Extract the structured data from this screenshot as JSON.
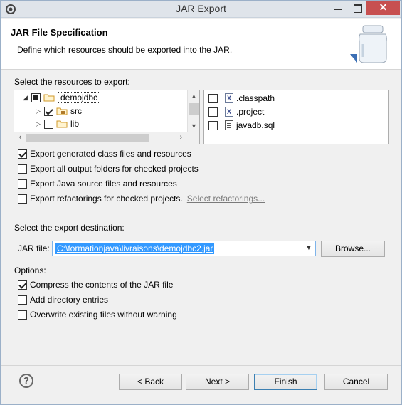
{
  "window": {
    "title": "JAR Export",
    "close_label": "✕"
  },
  "header": {
    "title": "JAR File Specification",
    "description": "Define which resources should be exported into the JAR."
  },
  "resources": {
    "label": "Select the resources to export:",
    "tree": [
      {
        "label": "demojdbc",
        "state": "partial",
        "expanded": true
      },
      {
        "label": "src",
        "state": "checked"
      },
      {
        "label": "lib",
        "state": "unchecked"
      }
    ],
    "files": [
      {
        "label": ".classpath",
        "icon": "x"
      },
      {
        "label": ".project",
        "icon": "x"
      },
      {
        "label": "javadb.sql",
        "icon": "db"
      }
    ]
  },
  "export_options": [
    {
      "label": "Export generated class files and resources",
      "checked": true
    },
    {
      "label": "Export all output folders for checked projects",
      "checked": false
    },
    {
      "label": "Export Java source files and resources",
      "checked": false
    },
    {
      "label": "Export refactorings for checked projects.",
      "checked": false,
      "link": "Select refactorings..."
    }
  ],
  "destination": {
    "label": "Select the export destination:",
    "jar_label": "JAR file:",
    "jar_value": "C:\\formationjava\\livraisons\\demojdbc2.jar",
    "browse_label": "Browse..."
  },
  "options": {
    "label": "Options:",
    "items": [
      {
        "label": "Compress the contents of the JAR file",
        "checked": true
      },
      {
        "label": "Add directory entries",
        "checked": false
      },
      {
        "label": "Overwrite existing files without warning",
        "checked": false
      }
    ]
  },
  "footer": {
    "help": "?",
    "back": "< Back",
    "next": "Next >",
    "finish": "Finish",
    "cancel": "Cancel"
  }
}
